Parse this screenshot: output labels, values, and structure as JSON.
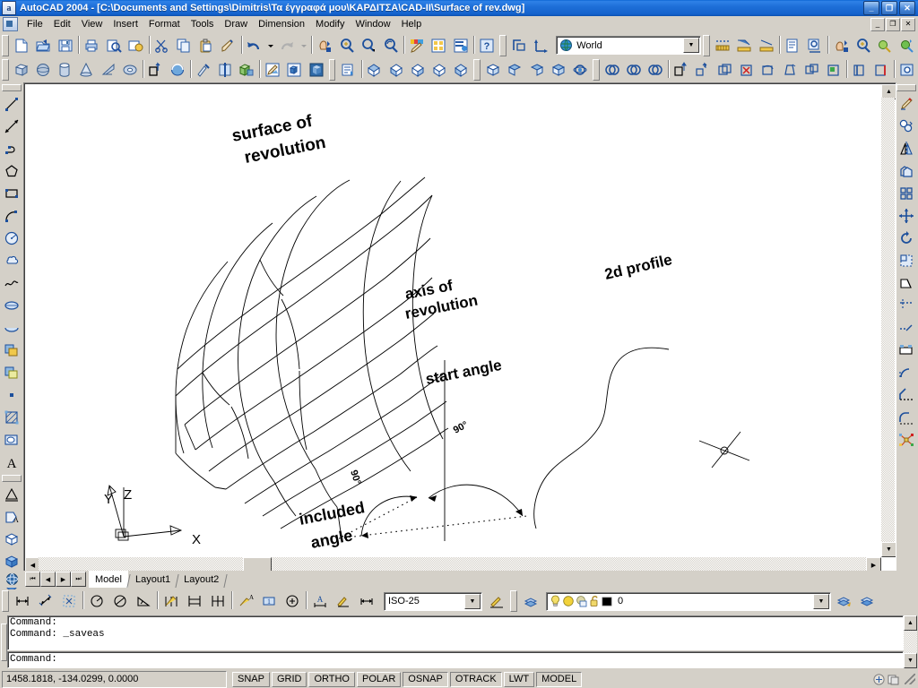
{
  "window": {
    "app_icon": "autocad-a-icon",
    "title": "AutoCAD 2004 - [C:\\Documents and Settings\\Dimitris\\Τα έγγραφά μου\\ΚΑΡΔΙΤΣΑ\\CAD-II\\Surface of rev.dwg]",
    "minimize": "_",
    "maximize": "❐",
    "close": "✕",
    "mdi_minimize": "_",
    "mdi_restore": "❐",
    "mdi_close": "✕"
  },
  "menubar": {
    "items": [
      {
        "label": "File"
      },
      {
        "label": "Edit"
      },
      {
        "label": "View"
      },
      {
        "label": "Insert"
      },
      {
        "label": "Format"
      },
      {
        "label": "Tools"
      },
      {
        "label": "Draw"
      },
      {
        "label": "Dimension"
      },
      {
        "label": "Modify"
      },
      {
        "label": "Window"
      },
      {
        "label": "Help"
      }
    ]
  },
  "standard_toolbar": {
    "buttons": [
      "new-icon",
      "open-icon",
      "save-icon",
      "print-icon",
      "print-preview-icon",
      "publish-icon",
      "cut-icon",
      "copy-icon",
      "paste-icon",
      "match-properties-icon",
      "undo-icon",
      "undo-dropdown-icon",
      "redo-icon",
      "redo-dropdown-icon",
      "pan-realtime-icon",
      "zoom-realtime-icon",
      "zoom-window-icon",
      "zoom-previous-icon",
      "properties-icon",
      "designcenter-icon",
      "tool-palettes-icon",
      "help-icon",
      "ucs-icon",
      "ucs-previous-icon"
    ]
  },
  "ucs_combo": {
    "value": "World",
    "icon": "globe-icon",
    "arrow": "▼"
  },
  "dim_toolbar_top": {
    "buttons": [
      "linear-dimension-icon",
      "aligned-dimension-icon",
      "ordinate-dimension-icon",
      "dim-style-icon",
      "dim-update-icon"
    ]
  },
  "zoom_toolbar": {
    "buttons": [
      "pan-icon",
      "zoom-icon",
      "zoom-dynamic-icon",
      "zoom-scale-icon"
    ]
  },
  "surfaces_toolbar": {
    "buttons": [
      "box-icon",
      "sphere-icon",
      "cylinder-icon",
      "cone-icon",
      "wedge-icon",
      "torus-icon",
      "extrude-icon",
      "revolve-icon",
      "slice-icon",
      "section-icon",
      "interfere-icon",
      "render-icon",
      "hide-icon",
      "shade-icon"
    ]
  },
  "view_toolbar": {
    "buttons": [
      "named-views-icon",
      "top-view-icon",
      "bottom-view-icon",
      "left-view-icon",
      "right-view-icon",
      "front-view-icon",
      "sw-iso-icon",
      "se-iso-icon",
      "ne-iso-icon",
      "nw-iso-icon",
      "3d-orbit-icon"
    ]
  },
  "solids_editing_toolbar": {
    "buttons": [
      "union-icon",
      "subtract-icon",
      "intersect-icon",
      "extrude-faces-icon",
      "move-faces-icon",
      "offset-faces-icon",
      "delete-faces-icon",
      "rotate-faces-icon",
      "taper-faces-icon",
      "copy-faces-icon",
      "color-faces-icon",
      "copy-edges-icon",
      "color-edges-icon",
      "imprint-icon"
    ]
  },
  "left_toolbar": {
    "buttons": [
      "line-icon",
      "construction-line-icon",
      "polyline-icon",
      "polygon-icon",
      "rectangle-icon",
      "arc-icon",
      "circle-icon",
      "revision-cloud-icon",
      "spline-icon",
      "ellipse-icon",
      "ellipse-arc-icon",
      "insert-block-icon",
      "make-block-icon",
      "point-icon",
      "hatch-icon",
      "region-icon",
      "multiline-text-icon"
    ],
    "group2": [
      "distance-icon",
      "area-icon",
      "3d-box-icon",
      "solid-box-icon",
      "solid-sphere-icon",
      "solid-wedge-icon",
      "3d-orbit-icon"
    ]
  },
  "right_toolbar": {
    "buttons": [
      "erase-icon",
      "copy-object-icon",
      "mirror-icon",
      "offset-icon",
      "array-icon",
      "move-icon",
      "rotate-icon",
      "scale-icon",
      "stretch-icon",
      "trim-icon",
      "extend-icon",
      "break-at-point-icon",
      "break-icon",
      "chamfer-icon",
      "fillet-icon",
      "explode-icon"
    ]
  },
  "drawing": {
    "labels": {
      "surface_of_revolution": [
        "surface of",
        "revolution"
      ],
      "axis_of_revolution": [
        "axis of",
        "revolution"
      ],
      "start_angle": "start angle",
      "included_angle": [
        "included",
        "angle"
      ],
      "profile": "2d profile",
      "start_angle_value": "90°",
      "included_angle_value": "90°"
    },
    "ucs_icon": {
      "x_label": "X",
      "y_label": "Y",
      "z_label": "Z"
    }
  },
  "layout_tabs": {
    "nav": [
      "⏮",
      "◀",
      "▶",
      "⏭"
    ],
    "tabs": [
      {
        "label": "Model",
        "active": true
      },
      {
        "label": "Layout1",
        "active": false
      },
      {
        "label": "Layout2",
        "active": false
      }
    ]
  },
  "dimension_toolbar": {
    "buttons": [
      "linear-dimension-icon",
      "aligned-dimension-icon",
      "ordinate-dimension-icon",
      "radius-dimension-icon",
      "diameter-dimension-icon",
      "angular-dimension-icon",
      "quick-dimension-icon",
      "baseline-dimension-icon",
      "continue-dimension-icon",
      "quick-leader-icon",
      "tolerance-icon",
      "center-mark-icon",
      "dim-edit-icon",
      "dim-text-edit-icon",
      "dim-update-icon"
    ]
  },
  "dimstyle_combo": {
    "value": "ISO-25",
    "arrow": "▼"
  },
  "layer_combo": {
    "value": "0",
    "arrow": "▼",
    "icons": [
      "lightbulb-on-icon",
      "freeze-sun-icon",
      "freeze-vp-icon",
      "unlock-icon",
      "color-swatch-icon"
    ],
    "color_swatch": "#000000"
  },
  "layers_toolbar": {
    "buttons": [
      "layer-properties-icon",
      "make-object-layer-current-icon",
      "layer-previous-icon"
    ]
  },
  "command_window": {
    "history": [
      "Command:",
      "Command: _saveas"
    ],
    "prompt": "Command:",
    "scroll_up": "▲",
    "scroll_down": "▼"
  },
  "statusbar": {
    "coordinates": "1458.1818, -134.0299, 0.0000",
    "toggles": [
      {
        "label": "SNAP",
        "pressed": false
      },
      {
        "label": "GRID",
        "pressed": false
      },
      {
        "label": "ORTHO",
        "pressed": false
      },
      {
        "label": "POLAR",
        "pressed": false
      },
      {
        "label": "OSNAP",
        "pressed": true
      },
      {
        "label": "OTRACK",
        "pressed": true
      },
      {
        "label": "LWT",
        "pressed": false
      },
      {
        "label": "MODEL",
        "pressed": true
      }
    ],
    "tray_icons": [
      "communication-center-icon",
      "manage-xrefs-icon"
    ]
  },
  "colors": {
    "title_gradient_start": "#0a63d2",
    "title_gradient_end": "#0a4fae",
    "ui_face": "#d4d0c8",
    "canvas_bg": "#ffffff",
    "drawing_ink": "#000000"
  }
}
